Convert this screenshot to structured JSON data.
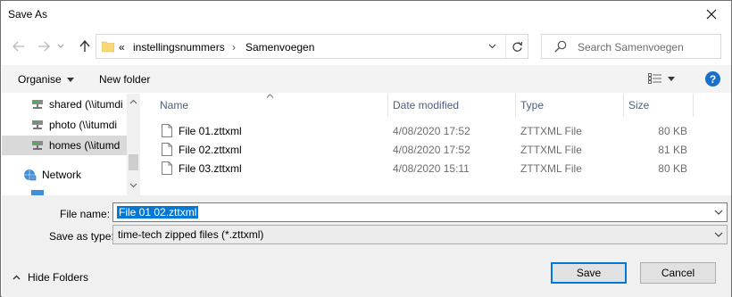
{
  "window": {
    "title": "Save As"
  },
  "address": {
    "overflow": "«",
    "crumbs": [
      "instellingsnummers",
      "Samenvoegen"
    ]
  },
  "search": {
    "placeholder": "Search Samenvoegen"
  },
  "toolbar": {
    "organise_label": "Organise",
    "new_folder_label": "New folder"
  },
  "navpane": {
    "items": [
      {
        "label": "shared (\\\\itumdi",
        "icon": "network-drive-icon",
        "selected": false
      },
      {
        "label": "photo (\\\\itumdi",
        "icon": "network-drive-icon",
        "selected": false
      },
      {
        "label": "homes (\\\\itumd",
        "icon": "network-drive-icon",
        "selected": true
      },
      {
        "label": "Network",
        "icon": "network-icon",
        "selected": false
      }
    ]
  },
  "files": {
    "columns": {
      "name": "Name",
      "date": "Date modified",
      "type": "Type",
      "size": "Size"
    },
    "rows": [
      {
        "name": "File 01.zttxml",
        "date": "4/08/2020 17:52",
        "type": "ZTTXML File",
        "size": "80 KB"
      },
      {
        "name": "File 02.zttxml",
        "date": "4/08/2020 17:52",
        "type": "ZTTXML File",
        "size": "81 KB"
      },
      {
        "name": "File 03.zttxml",
        "date": "4/08/2020 15:11",
        "type": "ZTTXML File",
        "size": "80 KB"
      }
    ]
  },
  "form": {
    "filename_label": "File name:",
    "filename_value": "File 01 02.zttxml",
    "savetype_label": "Save as type:",
    "savetype_value": "time-tech zipped files (*.zttxml)"
  },
  "buttons": {
    "save": "Save",
    "cancel": "Cancel",
    "hide_folders": "Hide Folders"
  },
  "colors": {
    "accent": "#0078d7",
    "help": "#1a6fc9",
    "folder": "#f8d775"
  }
}
